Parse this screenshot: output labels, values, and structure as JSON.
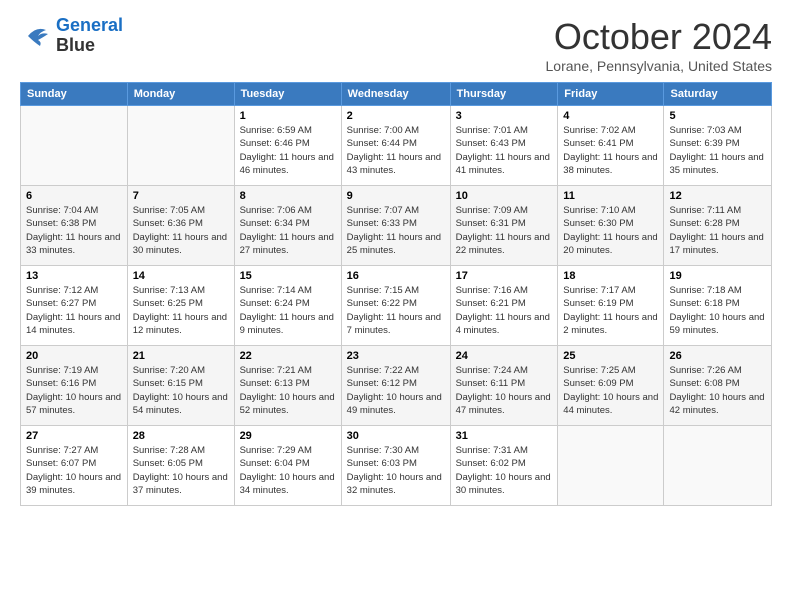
{
  "header": {
    "logo_line1": "General",
    "logo_line2": "Blue",
    "month_title": "October 2024",
    "location": "Lorane, Pennsylvania, United States"
  },
  "weekdays": [
    "Sunday",
    "Monday",
    "Tuesday",
    "Wednesday",
    "Thursday",
    "Friday",
    "Saturday"
  ],
  "weeks": [
    [
      {
        "day": "",
        "info": ""
      },
      {
        "day": "",
        "info": ""
      },
      {
        "day": "1",
        "info": "Sunrise: 6:59 AM\nSunset: 6:46 PM\nDaylight: 11 hours and 46 minutes."
      },
      {
        "day": "2",
        "info": "Sunrise: 7:00 AM\nSunset: 6:44 PM\nDaylight: 11 hours and 43 minutes."
      },
      {
        "day": "3",
        "info": "Sunrise: 7:01 AM\nSunset: 6:43 PM\nDaylight: 11 hours and 41 minutes."
      },
      {
        "day": "4",
        "info": "Sunrise: 7:02 AM\nSunset: 6:41 PM\nDaylight: 11 hours and 38 minutes."
      },
      {
        "day": "5",
        "info": "Sunrise: 7:03 AM\nSunset: 6:39 PM\nDaylight: 11 hours and 35 minutes."
      }
    ],
    [
      {
        "day": "6",
        "info": "Sunrise: 7:04 AM\nSunset: 6:38 PM\nDaylight: 11 hours and 33 minutes."
      },
      {
        "day": "7",
        "info": "Sunrise: 7:05 AM\nSunset: 6:36 PM\nDaylight: 11 hours and 30 minutes."
      },
      {
        "day": "8",
        "info": "Sunrise: 7:06 AM\nSunset: 6:34 PM\nDaylight: 11 hours and 27 minutes."
      },
      {
        "day": "9",
        "info": "Sunrise: 7:07 AM\nSunset: 6:33 PM\nDaylight: 11 hours and 25 minutes."
      },
      {
        "day": "10",
        "info": "Sunrise: 7:09 AM\nSunset: 6:31 PM\nDaylight: 11 hours and 22 minutes."
      },
      {
        "day": "11",
        "info": "Sunrise: 7:10 AM\nSunset: 6:30 PM\nDaylight: 11 hours and 20 minutes."
      },
      {
        "day": "12",
        "info": "Sunrise: 7:11 AM\nSunset: 6:28 PM\nDaylight: 11 hours and 17 minutes."
      }
    ],
    [
      {
        "day": "13",
        "info": "Sunrise: 7:12 AM\nSunset: 6:27 PM\nDaylight: 11 hours and 14 minutes."
      },
      {
        "day": "14",
        "info": "Sunrise: 7:13 AM\nSunset: 6:25 PM\nDaylight: 11 hours and 12 minutes."
      },
      {
        "day": "15",
        "info": "Sunrise: 7:14 AM\nSunset: 6:24 PM\nDaylight: 11 hours and 9 minutes."
      },
      {
        "day": "16",
        "info": "Sunrise: 7:15 AM\nSunset: 6:22 PM\nDaylight: 11 hours and 7 minutes."
      },
      {
        "day": "17",
        "info": "Sunrise: 7:16 AM\nSunset: 6:21 PM\nDaylight: 11 hours and 4 minutes."
      },
      {
        "day": "18",
        "info": "Sunrise: 7:17 AM\nSunset: 6:19 PM\nDaylight: 11 hours and 2 minutes."
      },
      {
        "day": "19",
        "info": "Sunrise: 7:18 AM\nSunset: 6:18 PM\nDaylight: 10 hours and 59 minutes."
      }
    ],
    [
      {
        "day": "20",
        "info": "Sunrise: 7:19 AM\nSunset: 6:16 PM\nDaylight: 10 hours and 57 minutes."
      },
      {
        "day": "21",
        "info": "Sunrise: 7:20 AM\nSunset: 6:15 PM\nDaylight: 10 hours and 54 minutes."
      },
      {
        "day": "22",
        "info": "Sunrise: 7:21 AM\nSunset: 6:13 PM\nDaylight: 10 hours and 52 minutes."
      },
      {
        "day": "23",
        "info": "Sunrise: 7:22 AM\nSunset: 6:12 PM\nDaylight: 10 hours and 49 minutes."
      },
      {
        "day": "24",
        "info": "Sunrise: 7:24 AM\nSunset: 6:11 PM\nDaylight: 10 hours and 47 minutes."
      },
      {
        "day": "25",
        "info": "Sunrise: 7:25 AM\nSunset: 6:09 PM\nDaylight: 10 hours and 44 minutes."
      },
      {
        "day": "26",
        "info": "Sunrise: 7:26 AM\nSunset: 6:08 PM\nDaylight: 10 hours and 42 minutes."
      }
    ],
    [
      {
        "day": "27",
        "info": "Sunrise: 7:27 AM\nSunset: 6:07 PM\nDaylight: 10 hours and 39 minutes."
      },
      {
        "day": "28",
        "info": "Sunrise: 7:28 AM\nSunset: 6:05 PM\nDaylight: 10 hours and 37 minutes."
      },
      {
        "day": "29",
        "info": "Sunrise: 7:29 AM\nSunset: 6:04 PM\nDaylight: 10 hours and 34 minutes."
      },
      {
        "day": "30",
        "info": "Sunrise: 7:30 AM\nSunset: 6:03 PM\nDaylight: 10 hours and 32 minutes."
      },
      {
        "day": "31",
        "info": "Sunrise: 7:31 AM\nSunset: 6:02 PM\nDaylight: 10 hours and 30 minutes."
      },
      {
        "day": "",
        "info": ""
      },
      {
        "day": "",
        "info": ""
      }
    ]
  ]
}
